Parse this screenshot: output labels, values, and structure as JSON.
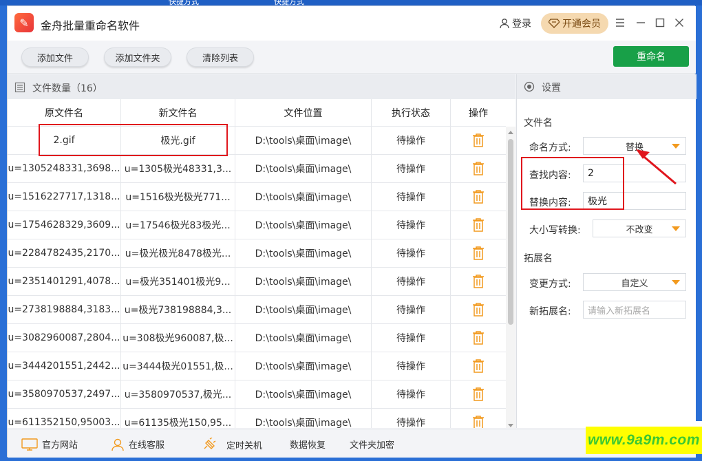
{
  "desktop": {
    "labels": [
      "快捷方式",
      "快捷方式"
    ]
  },
  "titlebar": {
    "title": "金舟批量重命名软件",
    "login": "登录",
    "vip": "开通会员"
  },
  "toolbar": {
    "add_file": "添加文件",
    "add_folder": "添加文件夹",
    "clear_list": "清除列表",
    "rename": "重命名"
  },
  "files": {
    "count_label": "文件数量（16）",
    "columns": [
      "原文件名",
      "新文件名",
      "文件位置",
      "执行状态",
      "操作"
    ],
    "rows": [
      [
        "2.gif",
        "极光.gif",
        "D:\\tools\\桌面\\image\\",
        "待操作"
      ],
      [
        "u=1305248331,3698...",
        "u=1305极光48331,3...",
        "D:\\tools\\桌面\\image\\",
        "待操作"
      ],
      [
        "u=1516227717,1318...",
        "u=1516极光极光771...",
        "D:\\tools\\桌面\\image\\",
        "待操作"
      ],
      [
        "u=1754628329,3609...",
        "u=17546极光83极光...",
        "D:\\tools\\桌面\\image\\",
        "待操作"
      ],
      [
        "u=2284782435,2170...",
        "u=极光极光8478极光...",
        "D:\\tools\\桌面\\image\\",
        "待操作"
      ],
      [
        "u=2351401291,4078...",
        "u=极光351401极光9...",
        "D:\\tools\\桌面\\image\\",
        "待操作"
      ],
      [
        "u=2738198884,3183...",
        "u=极光738198884,3...",
        "D:\\tools\\桌面\\image\\",
        "待操作"
      ],
      [
        "u=3082960087,2804...",
        "u=308极光960087,极...",
        "D:\\tools\\桌面\\image\\",
        "待操作"
      ],
      [
        "u=3444201551,2442...",
        "u=3444极光01551,极...",
        "D:\\tools\\桌面\\image\\",
        "待操作"
      ],
      [
        "u=3580970537,2497...",
        "u=3580970537,极光...",
        "D:\\tools\\桌面\\image\\",
        "待操作"
      ],
      [
        "u=611352150,95003...",
        "u=61135极光150,95...",
        "D:\\tools\\桌面\\image\\",
        "待操作"
      ]
    ]
  },
  "settings": {
    "header": "设置",
    "filename_section": "文件名",
    "naming_mode_label": "命名方式:",
    "naming_mode_value": "替换",
    "find_label": "查找内容:",
    "find_value": "2",
    "replace_label": "替换内容:",
    "replace_value": "极光",
    "case_label": "大小写转换:",
    "case_value": "不改变",
    "ext_section": "拓展名",
    "ext_mode_label": "变更方式:",
    "ext_mode_value": "自定义",
    "new_ext_label": "新拓展名:",
    "new_ext_placeholder": "请输入新拓展名"
  },
  "footer": {
    "website": "官方网站",
    "support": "在线客服",
    "shutdown": "定时关机",
    "recovery": "数据恢复",
    "encrypt": "文件夹加密"
  },
  "watermark": "www.9a9m.com",
  "colors": {
    "accent_green": "#18a048",
    "highlight_red": "#e0161d",
    "trash_orange": "#f29a1f"
  }
}
